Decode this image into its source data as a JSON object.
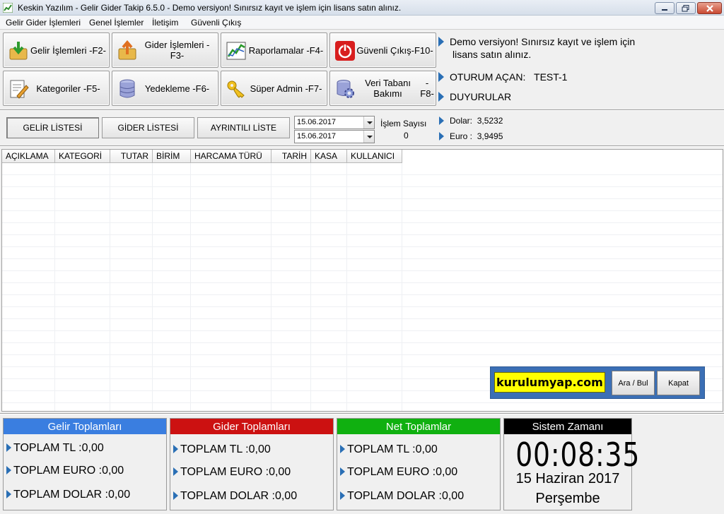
{
  "window": {
    "title": "Keskin Yazılım - Gelir Gider Takip 6.5.0  - Demo versiyon! Sınırsız kayıt ve işlem için lisans satın alınız."
  },
  "menu": [
    "Gelir Gider İşlemleri",
    "Genel İşlemler",
    "İletişim",
    "Güvenli Çıkış"
  ],
  "toolbar": {
    "income": "Gelir İşlemleri -F2-",
    "expense": "Gider İşlemleri -F3-",
    "reports": "Raporlamalar -F4-",
    "exit_line1": "Güvenli Çıkış",
    "exit_line2": "-F10-",
    "categories": "Kategoriler -F5-",
    "backup": "Yedekleme -F6-",
    "superadmin": "Süper Admin -F7-",
    "db_line1": "Veri Tabanı Bakımı",
    "db_line2": "-F8-"
  },
  "info": {
    "demo_line1": "Demo versiyon! Sınırsız kayıt ve işlem için",
    "demo_line2": "lisans satın alınız.",
    "session_label": "OTURUM AÇAN:",
    "session_user": "TEST-1",
    "announcements": "DUYURULAR"
  },
  "tabs": {
    "income_list": "GELİR LİSTESİ",
    "expense_list": "GİDER LİSTESİ",
    "detailed_list": "AYRINTILI LİSTE"
  },
  "filters": {
    "date_from": "15.06.2017",
    "date_to": "15.06.2017",
    "count_label": "İşlem Sayısı",
    "count_value": "0"
  },
  "rates": {
    "dollar_label": "Dolar:",
    "dollar_value": "3,5232",
    "euro_label": "Euro :",
    "euro_value": "3,9495"
  },
  "table": {
    "columns": [
      "AÇIKLAMA",
      "KATEGORİ",
      "TUTAR",
      "BİRİM",
      "HARCAMA TÜRÜ",
      "TARİH",
      "KASA",
      "KULLANICI"
    ],
    "rows": []
  },
  "search": {
    "value": "kurulumyap.com",
    "find_label": "Ara / Bul",
    "close_label": "Kapat"
  },
  "summary": {
    "income": {
      "title": "Gelir Toplamları",
      "tl": "TOPLAM TL :0,00",
      "euro": "TOPLAM EURO :0,00",
      "dollar": "TOPLAM DOLAR :0,00"
    },
    "expense": {
      "title": "Gider Toplamları",
      "tl": "TOPLAM TL :0,00",
      "euro": "TOPLAM EURO :0,00",
      "dollar": "TOPLAM DOLAR :0,00"
    },
    "net": {
      "title": "Net Toplamlar",
      "tl": "TOPLAM TL :0,00",
      "euro": "TOPLAM EURO :0,00",
      "dollar": "TOPLAM DOLAR :0,00"
    },
    "clock": {
      "title": "Sistem Zamanı",
      "time": "00:08:35",
      "date": "15 Haziran 2017",
      "day": "Perşembe"
    }
  },
  "colors": {
    "income_header": "#3a7ee0",
    "expense_header": "#cc1111",
    "net_header": "#10b010",
    "clock_header": "#000000",
    "arrow": "#2a6fb5",
    "search_bg": "#3b6fb5",
    "search_input": "#ffff00"
  }
}
